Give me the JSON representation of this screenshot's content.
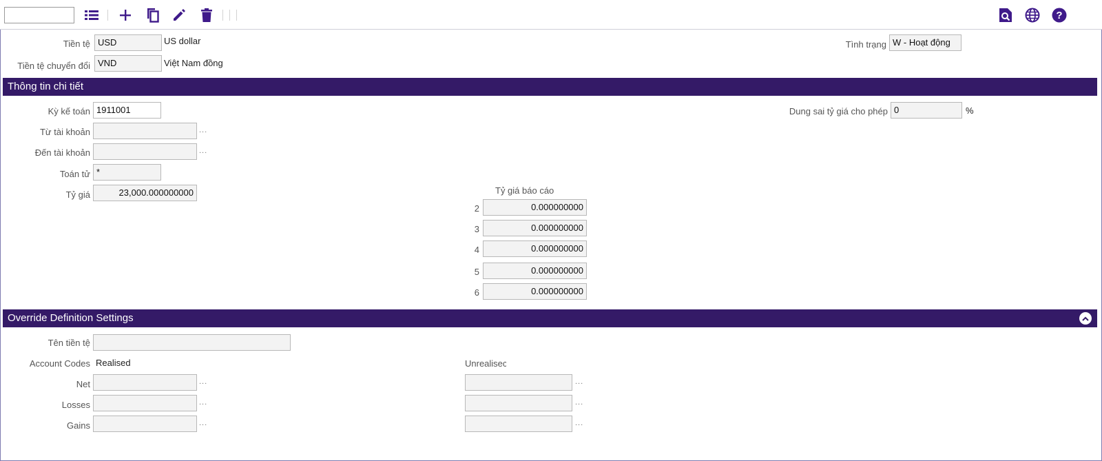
{
  "toolbar": {
    "search_value": "",
    "icons": [
      "list-icon",
      "add-icon",
      "copy-icon",
      "edit-icon",
      "delete-icon",
      "search-doc-icon",
      "globe-icon",
      "help-icon"
    ],
    "accent_color": "#3f1a8a"
  },
  "header": {
    "currency_label": "Tiền tệ",
    "currency_value": "USD",
    "currency_desc": "US dollar",
    "convert_label": "Tiền tệ chuyển đổi",
    "convert_value": "VND",
    "convert_desc": "Việt Nam đồng",
    "status_label": "Tình trạng",
    "status_value": "W - Hoạt động"
  },
  "details": {
    "section_title": "Thông tin chi tiết",
    "period_label": "Kỳ kế toán",
    "period_value": "1911001",
    "from_account_label": "Từ tài khoản",
    "from_account_value": "",
    "to_account_label": "Đến tài khoản",
    "to_account_value": "",
    "operator_label": "Toán tử",
    "operator_value": "*",
    "rate_label": "Tỷ giá",
    "rate_value": "23,000.000000000",
    "tolerance_label": "Dung sai tỷ giá cho phép",
    "tolerance_value": "0",
    "tolerance_unit": "%",
    "report_rate_title": "Tỷ giá báo cáo",
    "report_rates": [
      {
        "index": "2",
        "value": "0.000000000"
      },
      {
        "index": "3",
        "value": "0.000000000"
      },
      {
        "index": "4",
        "value": "0.000000000"
      },
      {
        "index": "5",
        "value": "0.000000000"
      },
      {
        "index": "6",
        "value": "0.000000000"
      }
    ]
  },
  "override": {
    "section_title": "Override Definition Settings",
    "currency_name_label": "Tên tiền tệ",
    "currency_name_value": "",
    "account_codes_label": "Account Codes",
    "realised_label": "Realised",
    "unrealised_label": "Unrealisec",
    "net_label": "Net",
    "losses_label": "Losses",
    "gains_label": "Gains",
    "dots": "..."
  },
  "colors": {
    "section_bar": "#341a67",
    "field_bg": "#f3f3f3"
  }
}
